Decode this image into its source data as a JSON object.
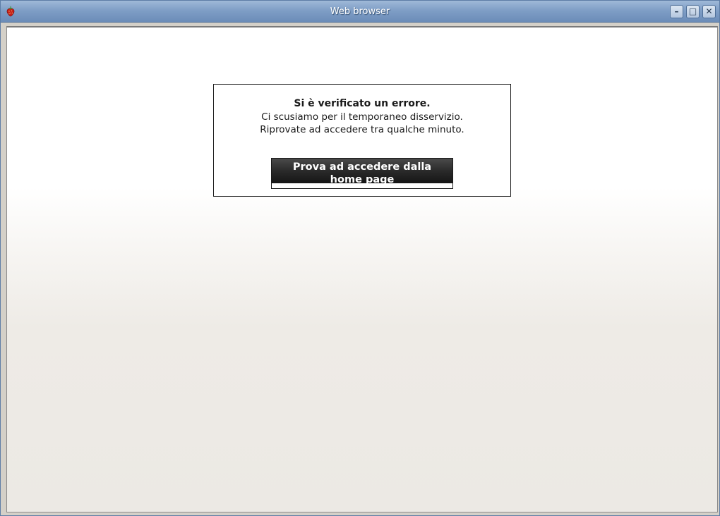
{
  "window": {
    "title": "Web browser",
    "controls": {
      "minimize": "–",
      "maximize": "□",
      "close": "✕"
    },
    "app_icon": "strawberry-icon"
  },
  "error_page": {
    "title": "Si è verificato un errore.",
    "line1": "Ci scusiamo per il temporaneo disservizio.",
    "line2": "Riprovate ad accedere tra qualche minuto.",
    "home_button_label": "Prova ad accedere dalla home page"
  },
  "colors": {
    "titlebar": "#7f9ec6",
    "button_face": "#2a2a2a",
    "page_background_bottom": "#ece9e4"
  }
}
